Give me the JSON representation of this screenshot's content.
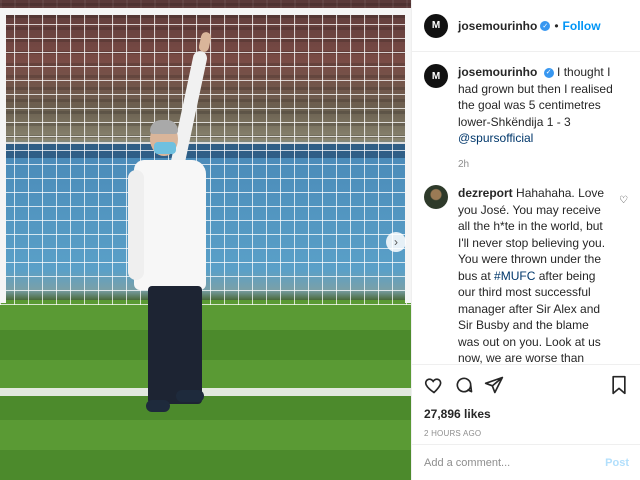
{
  "post": {
    "username": "josemourinho",
    "avatar_text": "M",
    "follow_label": "Follow",
    "dot": "•",
    "verified_icon": "verified-check",
    "caption": {
      "username": "josemourinho",
      "text": "I thought I had grown but then I realised the goal was 5 centimetres lower-Shkëndija 1 - 3",
      "mention": "@spursofficial",
      "time": "2h"
    },
    "comments": [
      {
        "username": "dezreport",
        "text_before": "Hahahaha. Love you José. You may receive all the h*te in the world, but I'll never stop believing you. You were thrown under the bus at",
        "hashtag": "#MUFC",
        "text_after": "after being our third most successful manager after Sir Alex and Sir Busby and the blame was out on you. Look at us now, we are worse than what you met. Wish you all the best at Spurs. From a Man Utd fan. ♥"
      }
    ],
    "likes": "27,896 likes",
    "posted_ago": "2 HOURS AGO",
    "add_comment_placeholder": "Add a comment...",
    "post_label": "Post",
    "colors": {
      "link": "#0095f6",
      "verified": "#3897f0",
      "muted": "#8e8e8e",
      "post_disabled": "#b2dffc"
    }
  }
}
